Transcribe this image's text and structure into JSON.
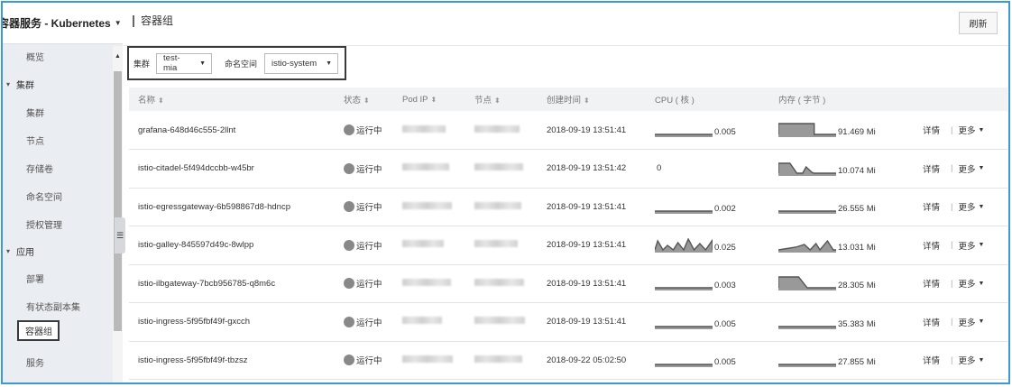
{
  "sidebar": {
    "title": "容器服务 - Kubernetes",
    "items": [
      {
        "label": "概览",
        "type": "sub"
      },
      {
        "label": "集群",
        "type": "group"
      },
      {
        "label": "集群",
        "type": "sub"
      },
      {
        "label": "节点",
        "type": "sub"
      },
      {
        "label": "存储卷",
        "type": "sub"
      },
      {
        "label": "命名空间",
        "type": "sub"
      },
      {
        "label": "授权管理",
        "type": "sub"
      },
      {
        "label": "应用",
        "type": "group"
      },
      {
        "label": "部署",
        "type": "sub"
      },
      {
        "label": "有状态副本集",
        "type": "sub"
      },
      {
        "label": "容器组",
        "type": "active"
      },
      {
        "label": "服务",
        "type": "sub"
      }
    ]
  },
  "header": {
    "title": "容器组",
    "refresh_label": "刷新"
  },
  "filter": {
    "cluster_label": "集群",
    "cluster_value": "test-mia",
    "namespace_label": "命名空间",
    "namespace_value": "istio-system"
  },
  "table": {
    "columns": [
      "名称",
      "状态",
      "Pod IP",
      "节点",
      "创建时间",
      "CPU ( 核 )",
      "内存 ( 字节 )",
      ""
    ],
    "rows": [
      {
        "name": "grafana-648d46c555-2llnt",
        "status": "运行中",
        "created": "2018-09-19 13:51:41",
        "cpu": "0.005",
        "mem": "91.469 Mi",
        "cpu_shape": "flat",
        "mem_shape": "block_end"
      },
      {
        "name": "istio-citadel-5f494dccbb-w45br",
        "status": "运行中",
        "created": "2018-09-19 13:51:42",
        "cpu": "0",
        "mem": "10.074 Mi",
        "cpu_shape": "none",
        "mem_shape": "dip"
      },
      {
        "name": "istio-egressgateway-6b598867d8-hdncp",
        "status": "运行中",
        "created": "2018-09-19 13:51:41",
        "cpu": "0.002",
        "mem": "26.555 Mi",
        "cpu_shape": "flat",
        "mem_shape": "flat"
      },
      {
        "name": "istio-galley-845597d49c-8wlpp",
        "status": "运行中",
        "created": "2018-09-19 13:51:41",
        "cpu": "0.025",
        "mem": "13.031 Mi",
        "cpu_shape": "spiky",
        "mem_shape": "spiky_small"
      },
      {
        "name": "istio-ilbgateway-7bcb956785-q8m6c",
        "status": "运行中",
        "created": "2018-09-19 13:51:41",
        "cpu": "0.003",
        "mem": "28.305 Mi",
        "cpu_shape": "flat",
        "mem_shape": "block_start"
      },
      {
        "name": "istio-ingress-5f95fbf49f-gxcch",
        "status": "运行中",
        "created": "2018-09-19 13:51:41",
        "cpu": "0.005",
        "mem": "35.383 Mi",
        "cpu_shape": "flat",
        "mem_shape": "flat"
      },
      {
        "name": "istio-ingress-5f95fbf49f-tbzsz",
        "status": "运行中",
        "created": "2018-09-22 05:02:50",
        "cpu": "0.005",
        "mem": "27.855 Mi",
        "cpu_shape": "flat",
        "mem_shape": "flat"
      }
    ],
    "detail_label": "详情",
    "more_label": "更多"
  }
}
